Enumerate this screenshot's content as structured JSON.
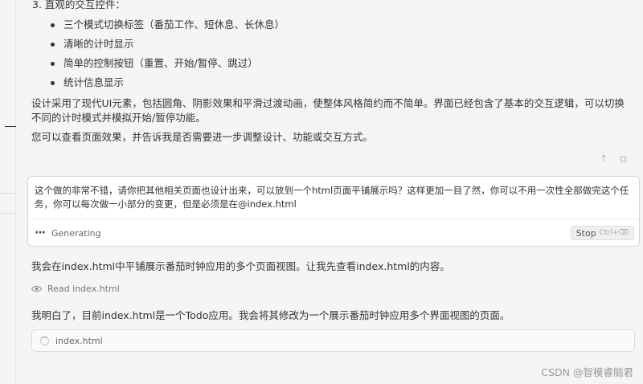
{
  "content": {
    "heading_item3": "3. 直观的交互控件：",
    "bullets": [
      "三个模式切换标签（番茄工作、短休息、长休息）",
      "清晰的计时显示",
      "简单的控制按钮（重置、开始/暂停、跳过）",
      "统计信息显示"
    ],
    "paragraph1": "设计采用了现代UI元素，包括圆角、阴影效果和平滑过渡动画，使整体风格简约而不简单。界面已经包含了基本的交互逻辑，可以切换不同的计时模式并模拟开始/暂停功能。",
    "paragraph2": "您可以查看页面效果，并告诉我是否需要进一步调整设计、功能或交互方式。"
  },
  "input": {
    "user_message": "这个做的非常不错，请你把其他相关页面也设计出来，可以放到一个html页面平铺展示吗？这样更加一目了然，你可以不用一次性全部做完这个任务，你可以每次做一小部分的变更，但是必须是在@index.html",
    "status_label": "Generating",
    "stop_label": "Stop",
    "stop_shortcut": "Ctrl+⌫"
  },
  "response": {
    "reply1": "我会在index.html中平铺展示番茄时钟应用的多个页面视图。让我先查看index.html的内容。",
    "read_label": "Read index.html",
    "reply2": "我明白了，目前index.html是一个Todo应用。我会将其修改为一个展示番茄时钟应用多个界面视图的页面。",
    "file_label": "index.html"
  },
  "watermark": "CSDN @智模睿脑君",
  "icons": {
    "copy_up": "arrow-up-icon",
    "copy": "copy-icon",
    "eye": "eye-icon",
    "spinner": "spinner-icon"
  }
}
